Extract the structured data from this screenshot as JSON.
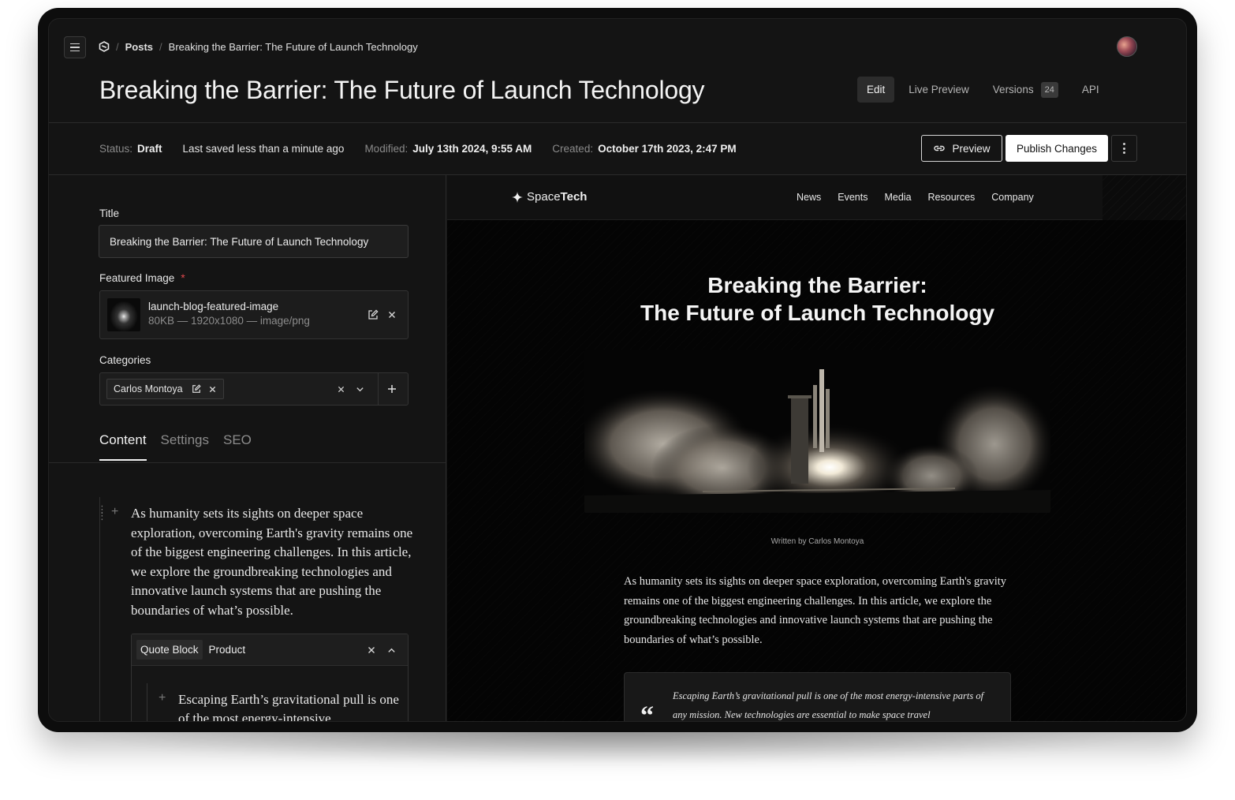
{
  "header": {
    "breadcrumbs": [
      "Posts",
      "Breaking the Barrier: The Future of Launch Technology"
    ],
    "page_title": "Breaking the Barrier: The Future of Launch Technology",
    "view_tabs": [
      {
        "label": "Edit",
        "active": true
      },
      {
        "label": "Live Preview"
      },
      {
        "label": "Versions",
        "badge": "24"
      },
      {
        "label": "API"
      }
    ]
  },
  "status_bar": {
    "status_label": "Status:",
    "status_value": "Draft",
    "last_saved": "Last saved less than a minute ago",
    "modified_label": "Modified:",
    "modified_value": "July 13th 2024, 9:55 AM",
    "created_label": "Created:",
    "created_value": "October 17th 2023, 2:47 PM",
    "preview_button": "Preview",
    "publish_button": "Publish Changes"
  },
  "form": {
    "title_label": "Title",
    "title_value": "Breaking the Barrier: The Future of Launch Technology",
    "featured_image_label": "Featured Image",
    "required_marker": "*",
    "image_name": "launch-blog-featured-image",
    "image_meta": "80KB — 1920x1080 — image/png",
    "categories_label": "Categories",
    "category_chip": "Carlos Montoya"
  },
  "content_tabs": [
    {
      "label": "Content",
      "active": true
    },
    {
      "label": "Settings"
    },
    {
      "label": "SEO"
    }
  ],
  "editor": {
    "paragraph": "As humanity sets its sights on deeper space exploration, overcoming Earth's gravity remains one of the biggest engineering challenges. In this article, we explore the groundbreaking technologies and innovative launch systems that are pushing the boundaries of what’s possible.",
    "block_type": "Quote Block",
    "block_subtype": "Product",
    "quote_text": "Escaping Earth’s gravitational pull is one of the most energy-intensive"
  },
  "preview": {
    "site_logo_light": "Space",
    "site_logo_bold": "Tech",
    "nav_links": [
      "News",
      "Events",
      "Media",
      "Resources",
      "Company"
    ],
    "article_title_line1": "Breaking the Barrier:",
    "article_title_line2": "The Future of Launch Technology",
    "caption": "Written by Carlos Montoya",
    "body": "As humanity sets its sights on deeper space exploration, overcoming Earth's gravity remains one of the biggest engineering challenges. In this article, we explore the groundbreaking technologies and innovative launch systems that are pushing the boundaries of what’s possible.",
    "quote_mark": "“",
    "quote": "Escaping Earth’s gravitational pull is one of the most energy-intensive parts of any mission. New technologies are essential to make space travel"
  },
  "icons": {
    "menu": "hamburger-icon",
    "logo": "hex-logo-icon",
    "link": "link-icon",
    "more": "kebab-icon",
    "edit": "edit-icon",
    "close": "close-icon",
    "chevron": "chevron-down-icon",
    "chevron_up": "chevron-up-icon",
    "plus": "plus-icon",
    "drag": "drag-handle-icon",
    "sparkle": "sparkle-icon"
  },
  "colors": {
    "background": "#141414",
    "accent_required": "#e0474c",
    "publish_bg": "#ffffff"
  }
}
